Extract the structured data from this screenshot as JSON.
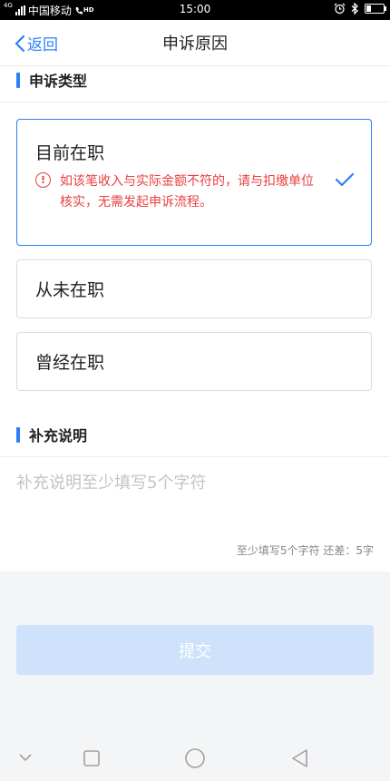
{
  "status_bar": {
    "network": "4G",
    "carrier": "中国移动",
    "hd": "HD",
    "time": "15:00"
  },
  "nav": {
    "back_label": "返回",
    "title": "申诉原因"
  },
  "section_type": {
    "title": "申诉类型"
  },
  "options": [
    {
      "label": "目前在职",
      "selected": true,
      "warning": "如该笔收入与实际金额不符的，请与扣缴单位核实，无需发起申诉流程。"
    },
    {
      "label": "从未在职",
      "selected": false
    },
    {
      "label": "曾经在职",
      "selected": false
    }
  ],
  "section_remark": {
    "title": "补充说明",
    "placeholder": "补充说明至少填写5个字符",
    "counter": "至少填写5个字符 还差：5字"
  },
  "submit_label": "提交",
  "colors": {
    "accent": "#2d7ff9",
    "warning": "#e84040",
    "submit_disabled": "#cfe2fb"
  }
}
